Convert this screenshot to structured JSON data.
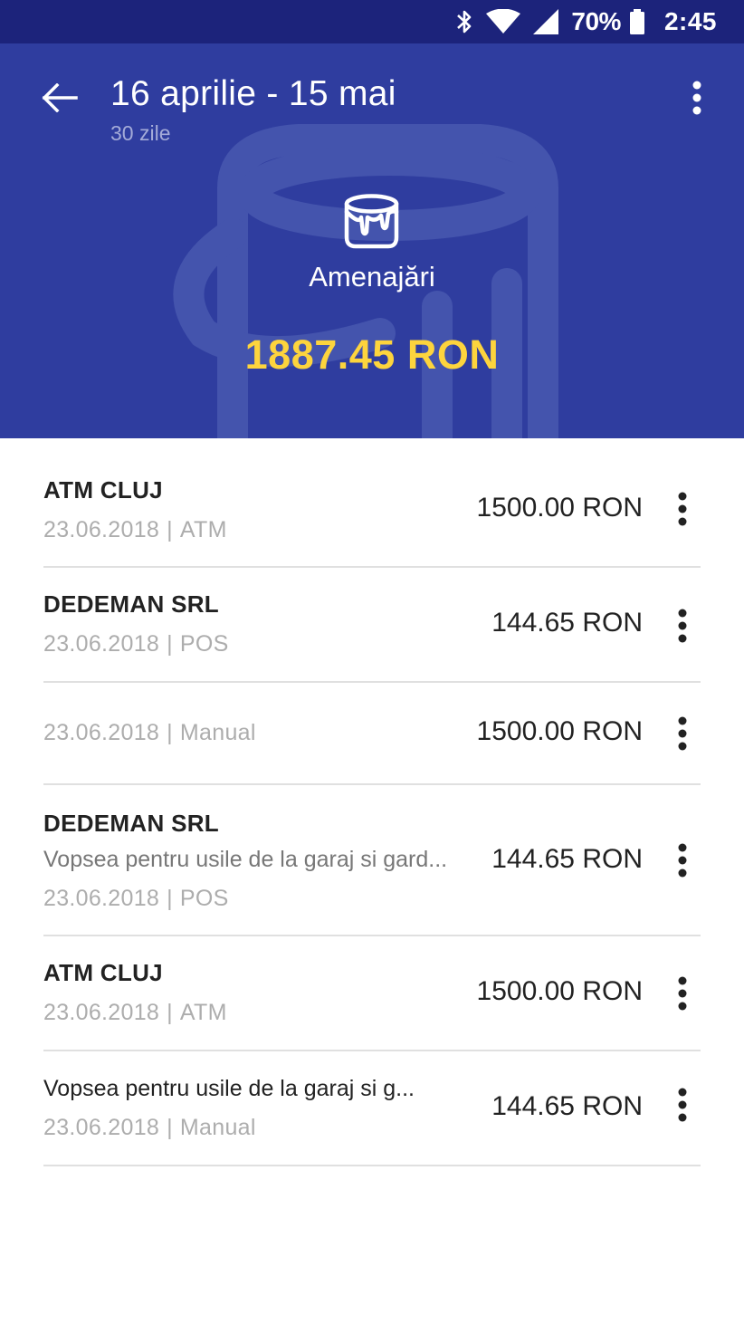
{
  "status_bar": {
    "battery_percent": "70%",
    "time": "2:45",
    "icons": [
      "bluetooth-icon",
      "wifi-icon",
      "signal-icon",
      "battery-icon"
    ]
  },
  "header": {
    "back_icon": "arrow-left-icon",
    "title": "16 aprilie - 15 mai",
    "subtitle": "30 zile",
    "menu_icon": "more-vertical-icon",
    "category_icon": "paint-bucket-icon",
    "category_name": "Amenajări",
    "total": "1887.45 RON",
    "background_color": "#2f3d9f",
    "accent_color": "#fdd43d"
  },
  "transactions": [
    {
      "merchant": "ATM CLUJ",
      "note": "",
      "date": "23.06.2018",
      "separator": "|",
      "source": "ATM",
      "amount": "1500.00 RON"
    },
    {
      "merchant": "DEDEMAN SRL",
      "note": "",
      "date": "23.06.2018",
      "separator": "|",
      "source": "POS",
      "amount": "144.65 RON"
    },
    {
      "merchant": "",
      "note": "",
      "date": "23.06.2018",
      "separator": "|",
      "source": "Manual",
      "amount": "1500.00 RON"
    },
    {
      "merchant": "DEDEMAN SRL",
      "note": "Vopsea pentru usile de la garaj si gard...",
      "date": "23.06.2018",
      "separator": "|",
      "source": "POS",
      "amount": "144.65 RON"
    },
    {
      "merchant": "ATM CLUJ",
      "note": "",
      "date": "23.06.2018",
      "separator": "|",
      "source": "ATM",
      "amount": "1500.00 RON"
    },
    {
      "merchant": "",
      "note": "Vopsea pentru usile de la garaj si g...",
      "date": "23.06.2018",
      "separator": "|",
      "source": "Manual",
      "amount": "144.65 RON"
    }
  ]
}
